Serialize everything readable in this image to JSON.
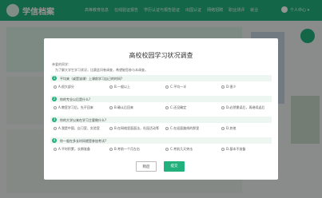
{
  "header": {
    "logo_text": "学信档案",
    "nav_items": [
      "高等教育信息",
      "在线验证报告",
      "学历认证与报告验证",
      "出国认证",
      "网络招聘",
      "职业测评",
      "就业"
    ],
    "user_label": "个人中心 ▾"
  },
  "side": {
    "caption": ""
  },
  "modal": {
    "title": "高校校园学习状况调查",
    "greeting": "亲爱的同学：",
    "intro": "为了解大学生学习状况，比赛此问卷调查，希望能您参与本调查。",
    "questions": [
      {
        "number": "1",
        "text": "平均来（或是该课）上课前学习自己的时间?",
        "options": [
          "A.很大部分",
          "B.一般以上",
          "C.平均一半",
          "D.很少"
        ]
      },
      {
        "number": "2",
        "text": "你的专业以后是什么?",
        "options": [
          "A.教室学习后，先不回来",
          "B.确认后回来",
          "C.还没确定",
          "D.必然需读后，再继续返后"
        ]
      },
      {
        "number": "3",
        "text": "你的大学以来在学习主要做什么?",
        "options": [
          "A.我是中国、自习室、实验室",
          "B.在网络里面面法，社园活动等",
          "C.在迎面路线的那里",
          "D.其他"
        ]
      },
      {
        "number": "4",
        "text": "你一般在多长时间就是参加考试?",
        "options": [
          "A.平时积累，长期准备",
          "B.考前一个月左右",
          "C.考前几天突击",
          "D.基本不准备"
        ]
      }
    ],
    "buttons": {
      "later": "稍后",
      "submit": "提交"
    }
  }
}
